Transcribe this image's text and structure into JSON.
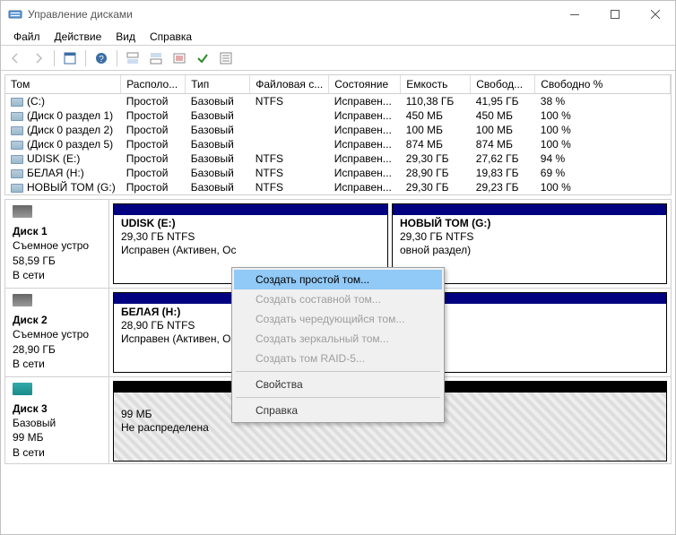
{
  "window": {
    "title": "Управление дисками"
  },
  "menu": {
    "file": "Файл",
    "action": "Действие",
    "view": "Вид",
    "help": "Справка"
  },
  "columns": {
    "volume": "Том",
    "layout": "Располо...",
    "type": "Тип",
    "filesystem": "Файловая с...",
    "status": "Состояние",
    "capacity": "Емкость",
    "free": "Свобод...",
    "freepct": "Свободно %"
  },
  "volumes": [
    {
      "name": "(C:)",
      "layout": "Простой",
      "type": "Базовый",
      "fs": "NTFS",
      "status": "Исправен...",
      "cap": "110,38 ГБ",
      "free": "41,95 ГБ",
      "pct": "38 %"
    },
    {
      "name": "(Диск 0 раздел 1)",
      "layout": "Простой",
      "type": "Базовый",
      "fs": "",
      "status": "Исправен...",
      "cap": "450 МБ",
      "free": "450 МБ",
      "pct": "100 %"
    },
    {
      "name": "(Диск 0 раздел 2)",
      "layout": "Простой",
      "type": "Базовый",
      "fs": "",
      "status": "Исправен...",
      "cap": "100 МБ",
      "free": "100 МБ",
      "pct": "100 %"
    },
    {
      "name": "(Диск 0 раздел 5)",
      "layout": "Простой",
      "type": "Базовый",
      "fs": "",
      "status": "Исправен...",
      "cap": "874 МБ",
      "free": "874 МБ",
      "pct": "100 %"
    },
    {
      "name": "UDISK (E:)",
      "layout": "Простой",
      "type": "Базовый",
      "fs": "NTFS",
      "status": "Исправен...",
      "cap": "29,30 ГБ",
      "free": "27,62 ГБ",
      "pct": "94 %"
    },
    {
      "name": "БЕЛАЯ (H:)",
      "layout": "Простой",
      "type": "Базовый",
      "fs": "NTFS",
      "status": "Исправен...",
      "cap": "28,90 ГБ",
      "free": "19,83 ГБ",
      "pct": "69 %"
    },
    {
      "name": "НОВЫЙ ТОМ (G:)",
      "layout": "Простой",
      "type": "Базовый",
      "fs": "NTFS",
      "status": "Исправен...",
      "cap": "29,30 ГБ",
      "free": "29,23 ГБ",
      "pct": "100 %"
    }
  ],
  "disks": {
    "d1": {
      "name": "Диск 1",
      "kind": "Съемное устро",
      "size": "58,59 ГБ",
      "state": "В сети",
      "p1": {
        "title": "UDISK  (E:)",
        "sub": "29,30 ГБ NTFS",
        "status": "Исправен (Активен, Ос"
      },
      "p2": {
        "title": "НОВЫЙ ТОМ  (G:)",
        "sub": "29,30 ГБ NTFS",
        "status": "овной раздел)"
      }
    },
    "d2": {
      "name": "Диск 2",
      "kind": "Съемное устро",
      "size": "28,90 ГБ",
      "state": "В сети",
      "p1": {
        "title": "БЕЛАЯ  (H:)",
        "sub": "28,90 ГБ NTFS",
        "status": "Исправен (Активен, Ос"
      }
    },
    "d3": {
      "name": "Диск 3",
      "kind": "Базовый",
      "size": "99 МБ",
      "state": "В сети",
      "p1": {
        "title": "",
        "sub": "99 МБ",
        "status": "Не распределена"
      }
    }
  },
  "legend": {
    "unallocated": "Не распределена",
    "primary": "Основной раздел"
  },
  "contextmenu": {
    "simple": "Создать простой том...",
    "spanned": "Создать составной том...",
    "striped": "Создать чередующийся том...",
    "mirrored": "Создать зеркальный том...",
    "raid5": "Создать том RAID-5...",
    "properties": "Свойства",
    "help": "Справка"
  },
  "colors": {
    "primary": "#000080",
    "unallocated": "#000000"
  }
}
